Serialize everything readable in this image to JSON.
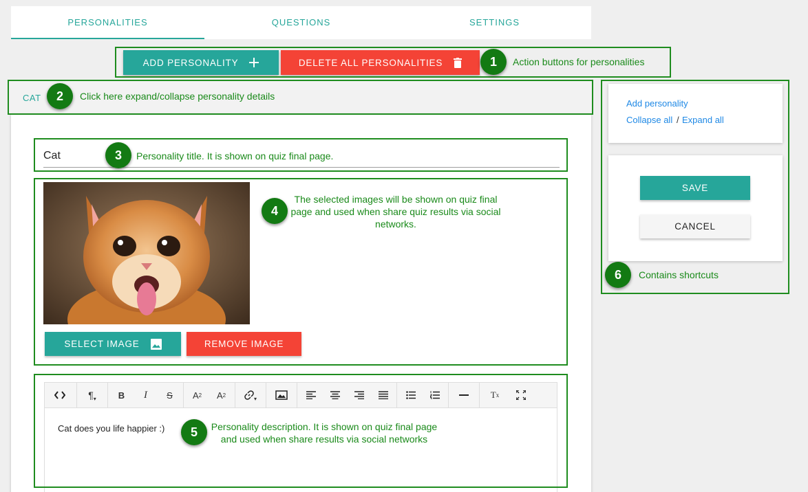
{
  "tabs": [
    {
      "label": "PERSONALITIES",
      "active": true
    },
    {
      "label": "QUESTIONS",
      "active": false
    },
    {
      "label": "SETTINGS",
      "active": false
    }
  ],
  "actions": {
    "add_label": "ADD PERSONALITY",
    "delete_label": "DELETE ALL PERSONALITIES"
  },
  "personality": {
    "header": "CAT",
    "title": "Cat",
    "image_alt": "orange kitten",
    "select_image_label": "SELECT IMAGE",
    "remove_image_label": "REMOVE IMAGE",
    "description": "Cat does you life happier :)"
  },
  "editor_toolbar": [
    "code-view",
    "paragraph",
    "bold",
    "italic",
    "strikethrough",
    "superscript",
    "subscript",
    "link",
    "image",
    "align-left",
    "align-center",
    "align-right",
    "align-justify",
    "bullet-list",
    "numbered-list",
    "horizontal-line",
    "clear-formatting",
    "fullscreen"
  ],
  "shortcuts": {
    "add_personality": "Add personality",
    "collapse_all": "Collapse all",
    "separator": "/",
    "expand_all": "Expand all"
  },
  "form": {
    "save_label": "SAVE",
    "cancel_label": "CANCEL"
  },
  "annotations": [
    {
      "number": "1",
      "text": "Action buttons for personalities"
    },
    {
      "number": "2",
      "text": "Click here expand/collapse personality details"
    },
    {
      "number": "3",
      "text": "Personality title. It is shown on quiz final page."
    },
    {
      "number": "4",
      "text": "The selected images will be shown on quiz final page and used when share quiz results via social networks."
    },
    {
      "number": "5",
      "text": "Personality description. It is shown on quiz final page and used when share results via social networks"
    },
    {
      "number": "6",
      "text": "Contains shortcuts"
    }
  ],
  "colors": {
    "accent_teal": "#26a69a",
    "danger_red": "#f44336",
    "annotation_green": "#1e8c1e",
    "link_blue": "#1e88e5"
  }
}
